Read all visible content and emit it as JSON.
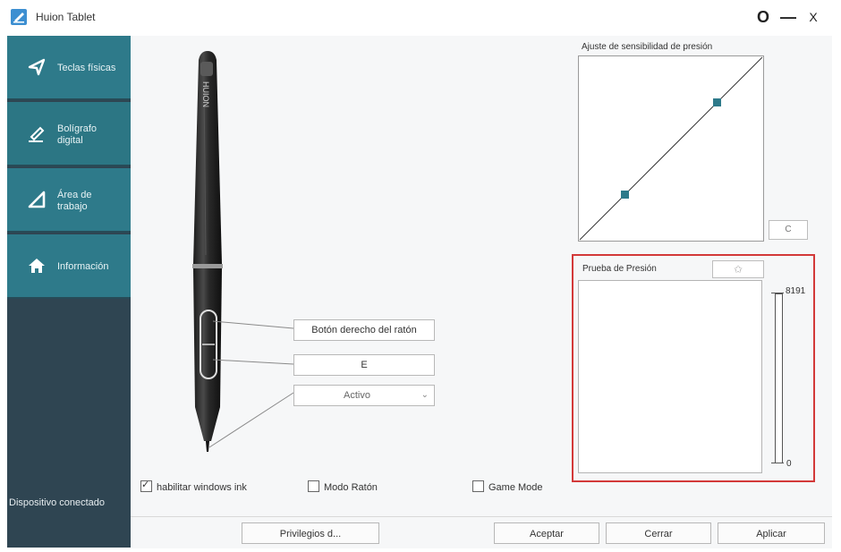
{
  "window": {
    "title": "Huion Tablet",
    "buttons": {
      "settings": "O",
      "minimize": "—",
      "close": "X"
    }
  },
  "sidebar": {
    "items": [
      {
        "label": "Teclas físicas",
        "icon": "send-icon"
      },
      {
        "label": "Bolígrafo digital",
        "icon": "pen-icon"
      },
      {
        "label": "Área de trabajo",
        "icon": "triangle-icon"
      },
      {
        "label": "Información",
        "icon": "home-icon"
      }
    ],
    "status": "Dispositivo conectado"
  },
  "pen": {
    "brand": "HUION",
    "upper_button": "Botón derecho del ratón",
    "lower_button": "E",
    "tip_mode": "Activo"
  },
  "curve": {
    "title": "Ajuste de sensibilidad de presión",
    "reset_label": "C",
    "control_points": [
      [
        0.25,
        0.25
      ],
      [
        0.75,
        0.75
      ]
    ]
  },
  "pressure": {
    "title": "Prueba de Presión",
    "clear_icon": "eraser-icon",
    "max": "8191",
    "min": "0",
    "level": 0
  },
  "options": {
    "windows_ink": {
      "label": "habilitar windows ink",
      "checked": true
    },
    "mouse_mode": {
      "label": "Modo Ratón",
      "checked": false
    },
    "game_mode": {
      "label": "Game Mode",
      "checked": false
    }
  },
  "footer": {
    "privileges": "Privilegios d...",
    "accept": "Aceptar",
    "close": "Cerrar",
    "apply": "Aplicar"
  },
  "colors": {
    "sidebar": "#2f4552",
    "nav_active": "#2e7a8a",
    "highlight": "#d33939",
    "curve_point": "#2e7a8a"
  }
}
